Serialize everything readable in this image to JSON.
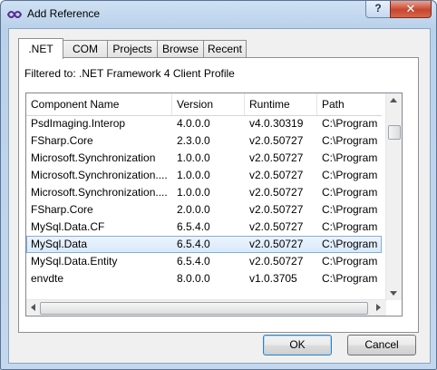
{
  "window": {
    "title": "Add Reference",
    "help_label": "?",
    "close_label": "✕"
  },
  "tabs": [
    {
      "label": ".NET",
      "active": true
    },
    {
      "label": "COM"
    },
    {
      "label": "Projects"
    },
    {
      "label": "Browse"
    },
    {
      "label": "Recent"
    }
  ],
  "filter_text": "Filtered to: .NET Framework 4 Client Profile",
  "columns": [
    "Component Name",
    "Version",
    "Runtime",
    "Path"
  ],
  "rows": [
    [
      "PsdImaging.Interop",
      "4.0.0.0",
      "v4.0.30319",
      "C:\\Program"
    ],
    [
      "FSharp.Core",
      "2.3.0.0",
      "v2.0.50727",
      "C:\\Program"
    ],
    [
      "Microsoft.Synchronization",
      "1.0.0.0",
      "v2.0.50727",
      "C:\\Program"
    ],
    [
      "Microsoft.Synchronization....",
      "1.0.0.0",
      "v2.0.50727",
      "C:\\Program"
    ],
    [
      "Microsoft.Synchronization....",
      "1.0.0.0",
      "v2.0.50727",
      "C:\\Program"
    ],
    [
      "FSharp.Core",
      "2.0.0.0",
      "v2.0.50727",
      "C:\\Program"
    ],
    [
      "MySql.Data.CF",
      "6.5.4.0",
      "v2.0.50727",
      "C:\\Program"
    ],
    [
      "MySql.Data",
      "6.5.4.0",
      "v2.0.50727",
      "C:\\Program"
    ],
    [
      "MySql.Data.Entity",
      "6.5.4.0",
      "v2.0.50727",
      "C:\\Program"
    ],
    [
      "envdte",
      "8.0.0.0",
      "v1.0.3705",
      "C:\\Program"
    ]
  ],
  "selected_row": 7,
  "buttons": {
    "ok": "OK",
    "cancel": "Cancel"
  }
}
